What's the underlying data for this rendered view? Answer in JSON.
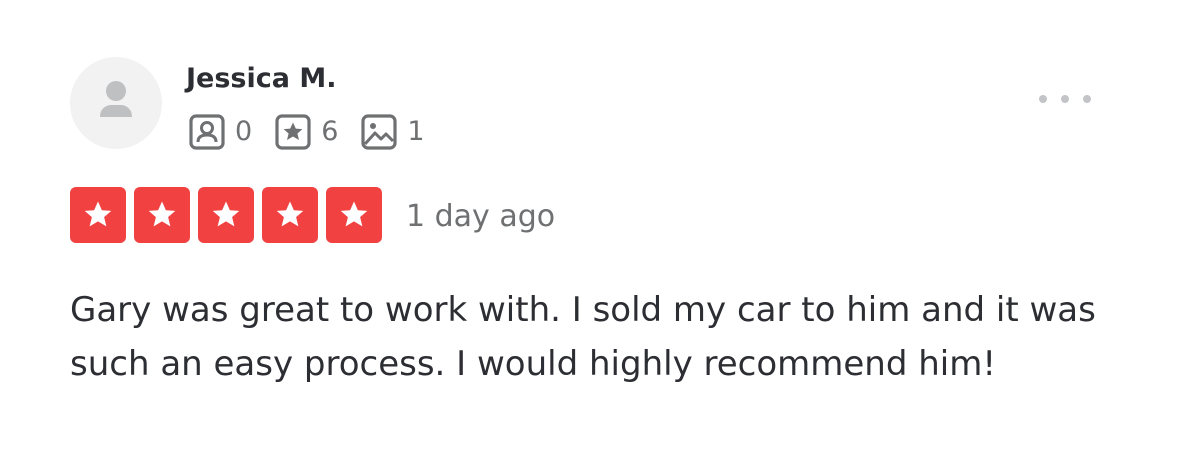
{
  "review": {
    "reviewer": {
      "name": "Jessica M.",
      "avatar_icon": "user-placeholder-icon"
    },
    "stats": [
      {
        "icon": "friends-icon",
        "value": "0"
      },
      {
        "icon": "reviews-icon",
        "value": "6"
      },
      {
        "icon": "photos-icon",
        "value": "1"
      }
    ],
    "more_menu_icon": "more-horizontal-icon",
    "rating": {
      "stars": 5,
      "out_of": 5,
      "star_color": "#f24141"
    },
    "date": "1 day ago",
    "text": "Gary was great to work with. I sold my car to him and it was such an easy process. I would highly recommend him!"
  }
}
